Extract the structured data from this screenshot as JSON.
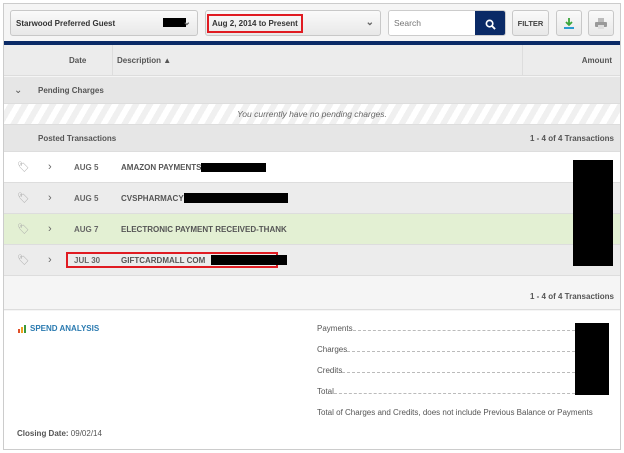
{
  "toolbar": {
    "account": "Starwood Preferred Guest",
    "date_range": "Aug 2, 2014 to Present",
    "search_placeholder": "Search",
    "filter_label": "FILTER",
    "icons": {
      "search": "search-icon",
      "download": "download-icon",
      "print": "print-icon"
    }
  },
  "table": {
    "columns": {
      "date": "Date",
      "description": "Description",
      "amount": "Amount"
    },
    "sort_indicator": "▲"
  },
  "pending": {
    "title": "Pending Charges",
    "empty_message": "You currently have no pending charges."
  },
  "posted": {
    "title": "Posted Transactions",
    "count": "1 - 4 of 4 Transactions",
    "rows": [
      {
        "date": "AUG 5",
        "description": "AMAZON PAYMENTS"
      },
      {
        "date": "AUG 5",
        "description": "CVSPHARMACY"
      },
      {
        "date": "AUG 7",
        "description": "ELECTRONIC PAYMENT RECEIVED-THANK"
      },
      {
        "date": "JUL 30",
        "description": "GIFTCARDMALL COM"
      }
    ],
    "footer_count": "1 - 4 of 4 Transactions"
  },
  "summary": {
    "spend_analysis": "SPEND ANALYSIS",
    "lines": [
      "Payments",
      "Charges",
      "Credits",
      "Total"
    ],
    "note": "Total of Charges and Credits, does not include Previous Balance or Payments",
    "closing_label": "Closing Date:",
    "closing_value": "09/02/14"
  },
  "colors": {
    "navy": "#0a2a66",
    "payment_row": "#e3f0d3",
    "highlight": "#e01b22",
    "link": "#2a7ab0"
  }
}
